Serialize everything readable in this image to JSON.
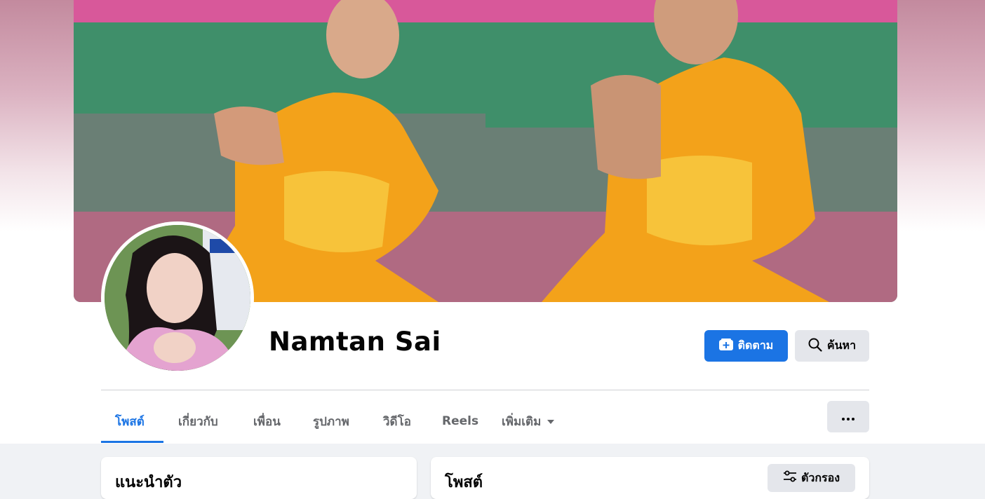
{
  "profile": {
    "name": "Namtan Sai"
  },
  "actions": {
    "follow_label": "ติดตาม",
    "search_label": "ค้นหา"
  },
  "tabs": [
    {
      "label": "โพสต์",
      "active": true
    },
    {
      "label": "เกี่ยวกับ",
      "active": false
    },
    {
      "label": "เพื่อน",
      "active": false
    },
    {
      "label": "รูปภาพ",
      "active": false
    },
    {
      "label": "วิดีโอ",
      "active": false
    },
    {
      "label": "Reels",
      "active": false
    },
    {
      "label": "เพิ่มเติม",
      "active": false
    }
  ],
  "intro_card": {
    "title": "แนะนำตัว"
  },
  "posts_card": {
    "title": "โพสต์",
    "filter_label": "ตัวกรอง"
  },
  "icons": {
    "follow": "add-friend-icon",
    "search": "search-icon",
    "more_tab": "caret-down-icon",
    "more_menu": "ellipsis-icon",
    "filter": "filter-sliders-icon"
  },
  "colors": {
    "accent": "#1b74e4",
    "page_background": "#f0f2f5",
    "secondary_button": "#e4e6eb"
  }
}
